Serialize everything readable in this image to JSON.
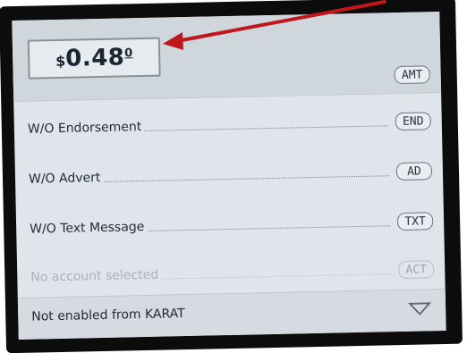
{
  "amount": {
    "currency": "$",
    "value": "0.48",
    "superscript": "0"
  },
  "keys": {
    "amt": "AMT",
    "end": "END",
    "ad": "AD",
    "txt": "TXT",
    "act": "ACT"
  },
  "options": [
    {
      "label": "W/O Endorsement",
      "key": "END"
    },
    {
      "label": "W/O Advert",
      "key": "AD"
    },
    {
      "label": "W/O Text Message",
      "key": "TXT"
    }
  ],
  "account": {
    "label": "No account selected"
  },
  "status": {
    "text": "Not enabled from KARAT"
  },
  "colors": {
    "arrow": "#c0161c",
    "screen": "#dfe5ea",
    "bezel": "#0c0c0c"
  }
}
